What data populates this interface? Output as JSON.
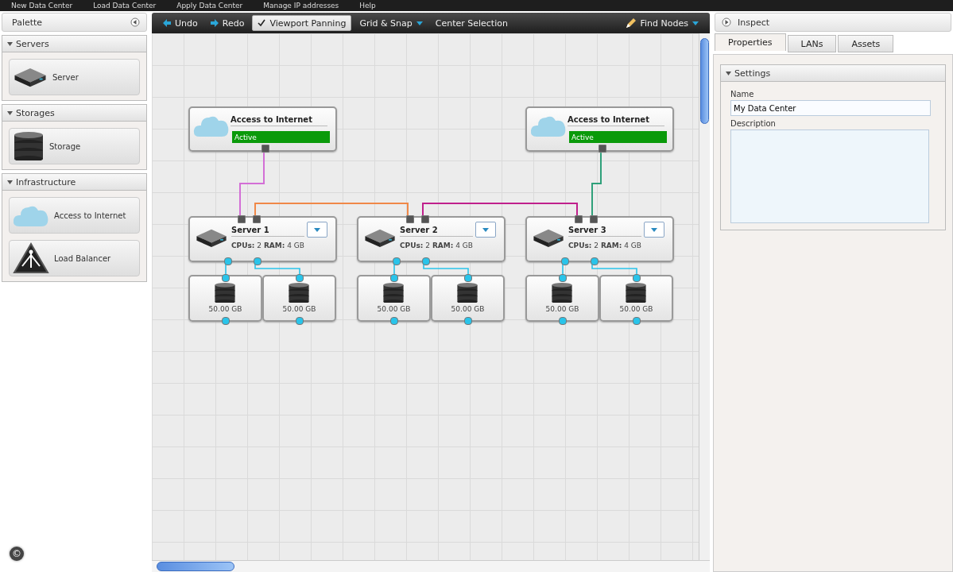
{
  "menu": [
    "New Data Center",
    "Load Data Center",
    "Apply Data Center",
    "Manage IP addresses",
    "Help"
  ],
  "palette": {
    "title": "Palette",
    "sections": [
      {
        "title": "Servers",
        "expanded": true,
        "items": [
          {
            "kind": "server",
            "label": "Server"
          }
        ]
      },
      {
        "title": "Storages",
        "expanded": true,
        "items": [
          {
            "kind": "storage",
            "label": "Storage"
          }
        ]
      },
      {
        "title": "Infrastructure",
        "expanded": true,
        "items": [
          {
            "kind": "internet",
            "label": "Access to Internet"
          },
          {
            "kind": "balancer",
            "label": "Load Balancer"
          }
        ]
      }
    ]
  },
  "toolbar": [
    {
      "kind": "undo",
      "label": "Undo"
    },
    {
      "kind": "redo",
      "label": "Redo"
    },
    {
      "kind": "toggle",
      "label": "Viewport Panning",
      "checked": true
    },
    {
      "kind": "dropdown",
      "label": "Grid & Snap"
    },
    {
      "kind": "plain",
      "label": "Center Selection"
    },
    {
      "kind": "find",
      "label": "Find Nodes"
    }
  ],
  "diagram": {
    "internet": [
      {
        "title": "Access to Internet",
        "status": "Active"
      },
      {
        "title": "Access to Internet",
        "status": "Active"
      }
    ],
    "servers": [
      {
        "name": "Server 1",
        "specs": "**CPUs:** 2 **RAM:** 4 GB",
        "storages": [
          "50.00 GB",
          "50.00 GB"
        ]
      },
      {
        "name": "Server 2",
        "specs": "**CPUs:** 2 **RAM:** 4 GB",
        "storages": [
          "50.00 GB",
          "50.00 GB"
        ]
      },
      {
        "name": "Server 3",
        "specs": "**CPUs:** 2 **RAM:** 4 GB",
        "storages": [
          "50.00 GB",
          "50.00 GB"
        ]
      }
    ],
    "connections": [
      {
        "color": "#d36fd6"
      },
      {
        "color": "#f08848"
      },
      {
        "color": "#c0208c"
      },
      {
        "color": "#2fa07a"
      }
    ]
  },
  "inspect": {
    "title": "Inspect",
    "tabs": [
      {
        "label": "Properties",
        "selected": true
      },
      {
        "label": "LANs",
        "selected": false
      },
      {
        "label": "Assets",
        "selected": false
      }
    ],
    "section": "Settings",
    "name_label": "Name",
    "name_value": "My Data Center",
    "description_label": "Description"
  },
  "footer": {
    "mark": "©"
  }
}
